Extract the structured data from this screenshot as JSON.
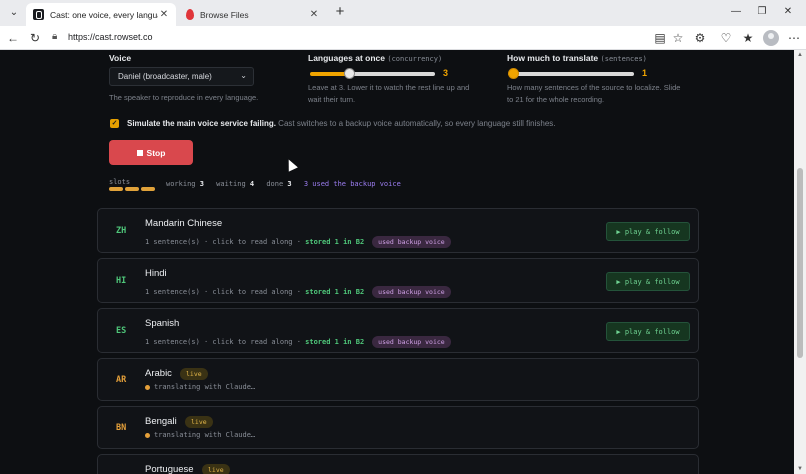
{
  "browser": {
    "tabs": [
      {
        "title": "Cast: one voice, every language",
        "active": true
      },
      {
        "title": "Browse Files",
        "active": false
      }
    ],
    "url": "https://cast.rowset.co"
  },
  "voice": {
    "label": "Voice",
    "selected": "Daniel (broadcaster, male)",
    "help": "The speaker to reproduce in every language."
  },
  "concurrency": {
    "label": "Languages at once",
    "hint": "(concurrency)",
    "value": "3",
    "level": 0.3,
    "help_line1": "Leave at 3. Lower it to watch the rest line up and",
    "help_line2": "wait their turn."
  },
  "sentences": {
    "label": "How much to translate",
    "hint": "(sentences)",
    "value": "1",
    "level": 0.0,
    "help_line1": "How many sentences of the source to localize. Slide",
    "help_line2": "to 21 for the whole recording."
  },
  "failover": {
    "checked": true,
    "label_bold": "Simulate the main voice service failing.",
    "label_rest": " Cast switches to a backup voice automatically, so every language still finishes."
  },
  "stop_button": "Stop",
  "status": {
    "slots_label": "slots",
    "working_label": "working",
    "working": "3",
    "waiting_label": "waiting",
    "waiting": "4",
    "done_label": "done",
    "done": "3",
    "backup": "3 used the backup voice"
  },
  "languages": [
    {
      "code": "ZH",
      "name": "Mandarin Chinese",
      "state": "done",
      "sub": "1 sentence(s) · click to read along · ",
      "stored": "stored 1 in B2",
      "badge": "used backup voice",
      "action": "▶ play & follow"
    },
    {
      "code": "HI",
      "name": "Hindi",
      "state": "done",
      "sub": "1 sentence(s) · click to read along · ",
      "stored": "stored 1 in B2",
      "badge": "used backup voice",
      "action": "▶ play & follow"
    },
    {
      "code": "ES",
      "name": "Spanish",
      "state": "done",
      "sub": "1 sentence(s) · click to read along · ",
      "stored": "stored 1 in B2",
      "badge": "used backup voice",
      "action": "▶ play & follow"
    },
    {
      "code": "AR",
      "name": "Arabic",
      "state": "live",
      "badge": "live",
      "sub": "translating with Claude…"
    },
    {
      "code": "BN",
      "name": "Bengali",
      "state": "live",
      "badge": "live",
      "sub": "translating with Claude…"
    },
    {
      "code": "",
      "name": "Portuguese",
      "state": "live",
      "badge": "live",
      "sub": ""
    }
  ]
}
